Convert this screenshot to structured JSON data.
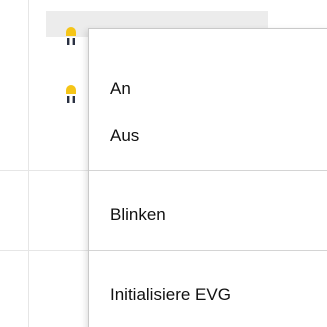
{
  "colors": {
    "lamp_body": "#f5c518",
    "lamp_pins": "#2a3142",
    "selection_bg": "#ececec",
    "menu_text": "#111111",
    "separator": "#d4d4d4"
  },
  "tree": {
    "items": [
      {
        "icon": "lamp-icon"
      },
      {
        "icon": "lamp-icon"
      }
    ]
  },
  "context_menu": {
    "items": [
      {
        "label": "An"
      },
      {
        "label": "Aus"
      },
      {
        "label": "Blinken"
      },
      {
        "label": "Initialisiere EVG"
      }
    ]
  }
}
